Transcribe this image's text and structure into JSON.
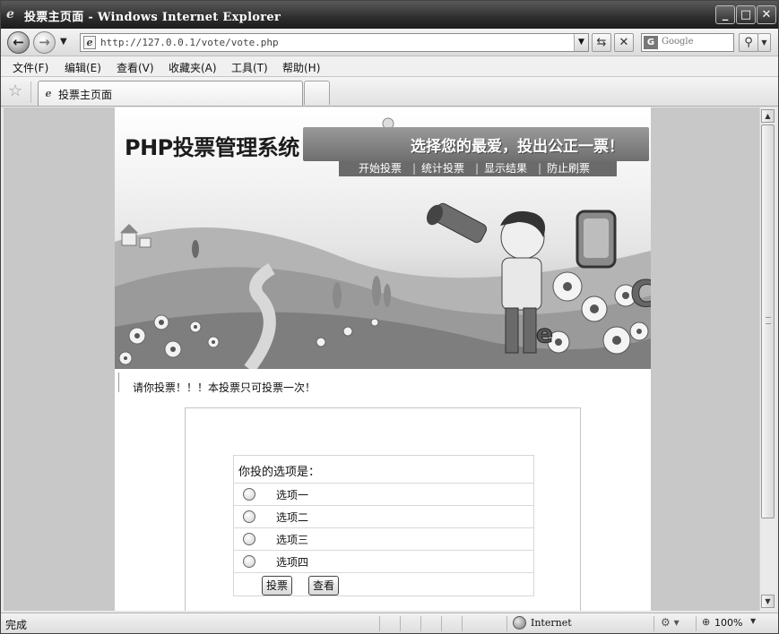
{
  "window": {
    "title": "投票主页面 - Windows Internet Explorer",
    "minimize_glyph": "_",
    "maximize_glyph": "□",
    "close_glyph": "✕"
  },
  "addressbar": {
    "url": "http://127.0.0.1/vote/vote.php",
    "search_placeholder": "Google"
  },
  "menu": {
    "items": [
      {
        "label": "文件(F)"
      },
      {
        "label": "编辑(E)"
      },
      {
        "label": "查看(V)"
      },
      {
        "label": "收藏夹(A)"
      },
      {
        "label": "工具(T)"
      },
      {
        "label": "帮助(H)"
      }
    ]
  },
  "tabs": [
    {
      "label": "投票主页面"
    }
  ],
  "site": {
    "brand": "PHP投票管理系统",
    "slogan": "选择您的最爱，投出公正一票！",
    "nav": [
      {
        "label": "开始投票"
      },
      {
        "label": "统计投票"
      },
      {
        "label": "显示结果"
      },
      {
        "label": "防止刷票"
      }
    ],
    "notice": "请你投票！！！本投票只可投票一次！"
  },
  "vote": {
    "title": "你投的选项是：",
    "options": [
      {
        "label": "选项一"
      },
      {
        "label": "选项二"
      },
      {
        "label": "选项三"
      },
      {
        "label": "选项四"
      }
    ],
    "submit_label": "投票",
    "view_label": "查看"
  },
  "statusbar": {
    "status": "完成",
    "zone": "Internet",
    "zoom": "100%"
  }
}
